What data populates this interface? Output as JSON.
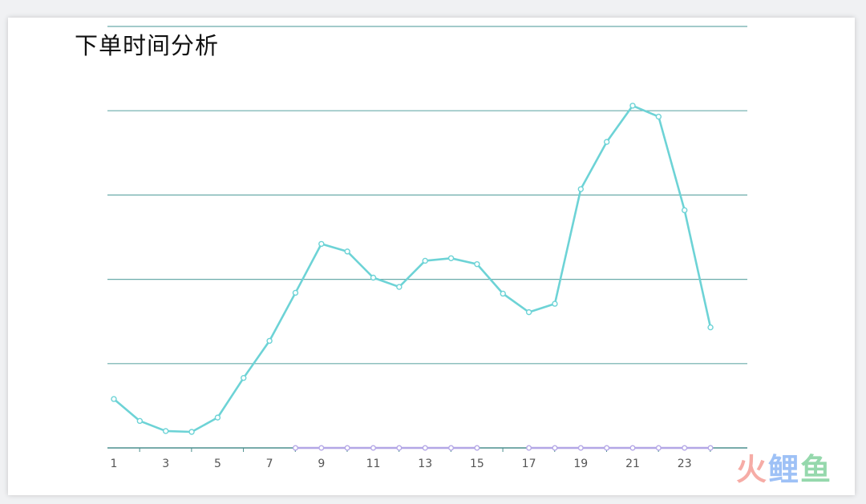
{
  "title": "下单时间分析",
  "watermark": {
    "part1": "火",
    "part2": "鲤",
    "part3": "鱼"
  },
  "colors": {
    "line": "#6dd3d6",
    "flat_line": "#b3a6e6",
    "grid": "#6aabaa",
    "axis": "#4b8f8e",
    "tick_label": "#555555"
  },
  "chart_data": {
    "type": "line",
    "title": "下单时间分析",
    "xlabel": "",
    "ylabel": "",
    "x": [
      1,
      2,
      3,
      4,
      5,
      6,
      7,
      8,
      9,
      10,
      11,
      12,
      13,
      14,
      15,
      16,
      17,
      18,
      19,
      20,
      21,
      22,
      23,
      24
    ],
    "x_tick_labels": [
      "1",
      "3",
      "5",
      "7",
      "9",
      "11",
      "13",
      "15",
      "17",
      "19",
      "21",
      "23"
    ],
    "x_tick_values": [
      1,
      3,
      5,
      7,
      9,
      11,
      13,
      15,
      17,
      19,
      21,
      23
    ],
    "ylim": [
      0,
      5
    ],
    "y_gridlines": [
      1,
      2,
      3,
      4,
      5
    ],
    "grid": true,
    "series": [
      {
        "values": [
          0.58,
          0.32,
          0.2,
          0.19,
          0.36,
          0.83,
          1.27,
          1.84,
          2.42,
          2.33,
          2.02,
          1.91,
          2.22,
          2.25,
          2.18,
          1.83,
          1.61,
          1.71,
          3.07,
          3.63,
          4.06,
          3.93,
          2.82,
          1.43
        ]
      },
      {
        "x": [
          8,
          9,
          10,
          11,
          12,
          13,
          14,
          15,
          17,
          18,
          19,
          20,
          21,
          22,
          23,
          24
        ],
        "values": [
          0,
          0,
          0,
          0,
          0,
          0,
          0,
          0,
          0,
          0,
          0,
          0,
          0,
          0,
          0,
          0
        ]
      }
    ]
  }
}
